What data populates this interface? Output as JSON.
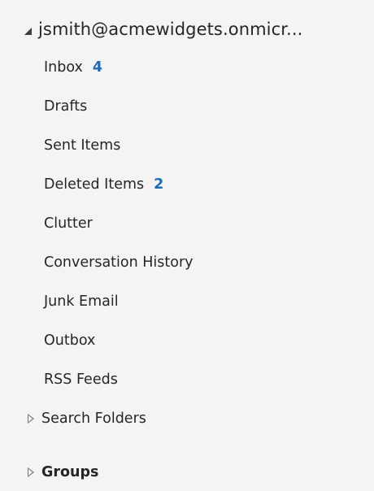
{
  "account": {
    "label": "jsmith@acmewidgets.onmicr..."
  },
  "folders": [
    {
      "label": "Inbox",
      "count": "4"
    },
    {
      "label": "Drafts"
    },
    {
      "label": "Sent Items"
    },
    {
      "label": "Deleted Items",
      "count": "2"
    },
    {
      "label": "Clutter"
    },
    {
      "label": "Conversation History"
    },
    {
      "label": "Junk Email"
    },
    {
      "label": "Outbox"
    },
    {
      "label": "RSS Feeds"
    }
  ],
  "search_folders": {
    "label": "Search Folders"
  },
  "groups": {
    "label": "Groups"
  },
  "colors": {
    "unread_count": "#1e6ab6",
    "pane_background": "#f4f4f4",
    "text": "#262626"
  }
}
